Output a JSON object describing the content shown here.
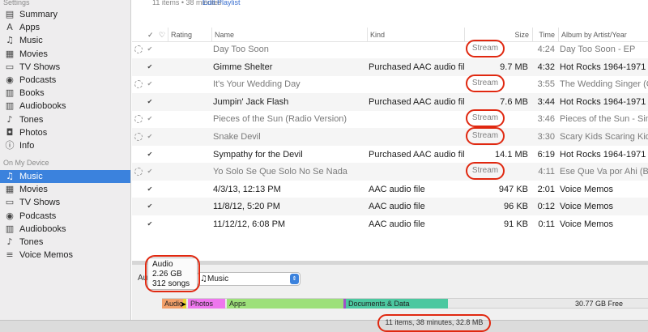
{
  "sidebar": {
    "settings_header": "Settings",
    "settings_items": [
      {
        "label": "Summary",
        "icon": "summary-icon"
      },
      {
        "label": "Apps",
        "icon": "apps-icon"
      },
      {
        "label": "Music",
        "icon": "music-note-icon"
      },
      {
        "label": "Movies",
        "icon": "film-icon"
      },
      {
        "label": "TV Shows",
        "icon": "tv-icon"
      },
      {
        "label": "Podcasts",
        "icon": "podcast-icon"
      },
      {
        "label": "Books",
        "icon": "book-icon"
      },
      {
        "label": "Audiobooks",
        "icon": "audiobook-icon"
      },
      {
        "label": "Tones",
        "icon": "bell-icon"
      },
      {
        "label": "Photos",
        "icon": "camera-icon"
      },
      {
        "label": "Info",
        "icon": "info-icon"
      }
    ],
    "device_header": "On My Device",
    "device_items": [
      {
        "label": "Music",
        "icon": "music-note-icon",
        "selected": true
      },
      {
        "label": "Movies",
        "icon": "film-icon"
      },
      {
        "label": "TV Shows",
        "icon": "tv-icon"
      },
      {
        "label": "Podcasts",
        "icon": "podcast-icon"
      },
      {
        "label": "Audiobooks",
        "icon": "audiobook-icon"
      },
      {
        "label": "Tones",
        "icon": "bell-icon"
      },
      {
        "label": "Voice Memos",
        "icon": "voice-memo-icon"
      }
    ]
  },
  "header": {
    "count": "11 items • 38 minutes",
    "edit_playlist": "Edit Playlist"
  },
  "table": {
    "columns": {
      "check": "✓",
      "heart": "♡",
      "rating": "Rating",
      "name": "Name",
      "kind": "Kind",
      "size": "Size",
      "time": "Time",
      "album": "Album by Artist/Year"
    },
    "rows": [
      {
        "name": "Day Too Soon",
        "kind": "",
        "size": "Stream",
        "time": "4:24",
        "album": "Day Too Soon - EP",
        "stream": true
      },
      {
        "name": "Gimme Shelter",
        "kind": "Purchased AAC audio file",
        "size": "9.7 MB",
        "time": "4:32",
        "album": "Hot Rocks 1964-1971",
        "stream": false
      },
      {
        "name": "It's Your Wedding Day",
        "kind": "",
        "size": "Stream",
        "time": "3:55",
        "album": "The Wedding Singer (Origi",
        "stream": true
      },
      {
        "name": "Jumpin' Jack Flash",
        "kind": "Purchased AAC audio file",
        "size": "7.6 MB",
        "time": "3:44",
        "album": "Hot Rocks 1964-1971",
        "stream": false
      },
      {
        "name": "Pieces of the Sun (Radio Version)",
        "kind": "",
        "size": "Stream",
        "time": "3:46",
        "album": "Pieces of the Sun - Single",
        "stream": true
      },
      {
        "name": "Snake Devil",
        "kind": "",
        "size": "Stream",
        "time": "3:30",
        "album": "Scary Kids Scaring Kids",
        "stream": true
      },
      {
        "name": "Sympathy for the Devil",
        "kind": "Purchased AAC audio file",
        "size": "14.1 MB",
        "time": "6:19",
        "album": "Hot Rocks 1964-1971",
        "stream": false
      },
      {
        "name": "Yo Solo Se Que Solo No Se Nada",
        "kind": "",
        "size": "Stream",
        "time": "4:11",
        "album": "Ese Que Va por Ahi (Bonus",
        "stream": true
      },
      {
        "name": "4/3/13, 12:13 PM",
        "kind": "AAC audio file",
        "size": "947 KB",
        "time": "2:01",
        "album": "Voice Memos",
        "stream": false
      },
      {
        "name": "11/8/12, 5:20 PM",
        "kind": "AAC audio file",
        "size": "96 KB",
        "time": "0:12",
        "album": "Voice Memos",
        "stream": false
      },
      {
        "name": "11/12/12, 6:08 PM",
        "kind": "AAC audio file",
        "size": "91 KB",
        "time": "0:11",
        "album": "Voice Memos",
        "stream": false
      }
    ]
  },
  "lower": {
    "auto_fill_label": "Au",
    "source_select": "Music",
    "tooltip": {
      "title": "Audio",
      "size": "2.26 GB",
      "count": "312 songs"
    }
  },
  "capacity": {
    "segments": [
      {
        "label": "Audio",
        "color": "#f2a06a"
      },
      {
        "label": "",
        "color": "#e9d030"
      },
      {
        "label": "Photos",
        "color": "#ee77ee"
      },
      {
        "label": "Apps",
        "color": "#9de07a"
      },
      {
        "label": "",
        "color": "#a050c8"
      },
      {
        "label": "Documents & Data",
        "color": "#4cc8a0"
      }
    ],
    "free": "30.77 GB Free"
  },
  "status": "11 items, 38 minutes, 32.8 MB",
  "colors": {
    "accent": "#3b82dd",
    "annotation": "#e02810"
  }
}
